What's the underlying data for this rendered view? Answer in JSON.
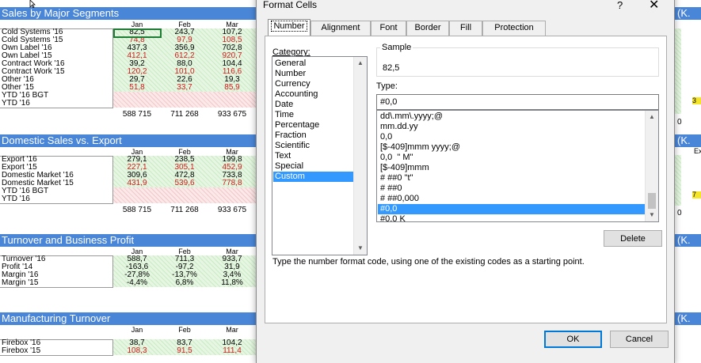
{
  "sheet": {
    "sections": [
      {
        "title": "Sales by Major Segments",
        "months": [
          "Jan",
          "Feb",
          "Mar"
        ],
        "rows": [
          {
            "label": "Cold Systems '16",
            "v": [
              "82,5",
              "243,7",
              "107,2"
            ],
            "red": false
          },
          {
            "label": "Cold Systems '15",
            "v": [
              "74,8",
              "97,9",
              "108,5"
            ],
            "red": true
          },
          {
            "label": "Own Label '16",
            "v": [
              "437,3",
              "356,9",
              "702,8"
            ],
            "red": false
          },
          {
            "label": "Own Label '15",
            "v": [
              "412,1",
              "612,2",
              "920,7"
            ],
            "red": true
          },
          {
            "label": "Contract Work '16",
            "v": [
              "39,2",
              "88,0",
              "104,4"
            ],
            "red": false
          },
          {
            "label": "Contract Work '15",
            "v": [
              "120,2",
              "101,0",
              "116,6"
            ],
            "red": true
          },
          {
            "label": "Other '16",
            "v": [
              "29,7",
              "22,6",
              "19,3"
            ],
            "red": false
          },
          {
            "label": "Other '15",
            "v": [
              "51,8",
              "33,7",
              "85,9"
            ],
            "red": true
          },
          {
            "label": "YTD '16 BGT",
            "v": [
              "",
              "",
              ""
            ],
            "red": false
          },
          {
            "label": "YTD '16",
            "v": [
              "",
              "",
              ""
            ],
            "red": false
          }
        ],
        "totals": [
          "588 715",
          "711 268",
          "933 675"
        ]
      },
      {
        "title": "Domestic Sales vs. Export",
        "months": [
          "Jan",
          "Feb",
          "Mar"
        ],
        "rows": [
          {
            "label": "Export '16",
            "v": [
              "279,1",
              "238,5",
              "199,8"
            ],
            "red": false
          },
          {
            "label": "Export '15",
            "v": [
              "227,1",
              "305,1",
              "452,9"
            ],
            "red": true
          },
          {
            "label": "Domestic Market '16",
            "v": [
              "309,6",
              "472,8",
              "733,8"
            ],
            "red": false
          },
          {
            "label": "Domestic Market '15",
            "v": [
              "431,9",
              "539,6",
              "778,8"
            ],
            "red": true
          },
          {
            "label": "YTD '16 BGT",
            "v": [
              "",
              "",
              ""
            ],
            "red": false
          },
          {
            "label": "YTD '16",
            "v": [
              "",
              "",
              ""
            ],
            "red": false
          }
        ],
        "totals": [
          "588 715",
          "711 268",
          "933 675"
        ]
      },
      {
        "title": "Turnover and Business Profit",
        "months": [
          "Jan",
          "Feb",
          "Mar"
        ],
        "rows": [
          {
            "label": "Turnover '16",
            "v": [
              "588,7",
              "711,3",
              "933,7"
            ],
            "red": false
          },
          {
            "label": "Profit '14",
            "v": [
              "-163,6",
              "-97,2",
              "31,9"
            ],
            "red": false
          },
          {
            "label": "Margin '16",
            "v": [
              "-27,8%",
              "-13,7%",
              "3,4%"
            ],
            "red": false
          },
          {
            "label": "Margin '15",
            "v": [
              "-4,4%",
              "6,8%",
              "11,8%"
            ],
            "red": false
          }
        ]
      },
      {
        "title": "Manufacturing Turnover",
        "months": [
          "Jan",
          "Feb",
          "Mar"
        ],
        "rows": [
          {
            "label": "Firebox '16",
            "v": [
              "38,7",
              "83,7",
              "104,2"
            ],
            "red": false
          },
          {
            "label": "Firebox '15",
            "v": [
              "108,3",
              "91,5",
              "111,4"
            ],
            "red": true
          }
        ]
      }
    ],
    "right_labels": [
      "(K.",
      "(K.",
      "(K.",
      "(K."
    ],
    "right_values": [
      "3",
      "0",
      "7",
      "0"
    ],
    "right_extra": "Ex"
  },
  "dialog": {
    "title": "Format Cells",
    "help": "?",
    "close": "✕",
    "tabs": [
      "Number",
      "Alignment",
      "Font",
      "Border",
      "Fill",
      "Protection"
    ],
    "active_tab": "Number",
    "category_label": "Category:",
    "categories": [
      "General",
      "Number",
      "Currency",
      "Accounting",
      "Date",
      "Time",
      "Percentage",
      "Fraction",
      "Scientific",
      "Text",
      "Special",
      "Custom"
    ],
    "selected_category": "Custom",
    "sample_label": "Sample",
    "sample_value": "82,5",
    "type_label": "Type:",
    "type_value": "#0,0",
    "formats": [
      "dd\\.mm\\.yyyy;@",
      "mm.dd.yy",
      "0,0",
      "[$-409]mmm yyyy;@",
      "0,0  \" M\"",
      "[$-409]mmm",
      "# ##0 \"t\"",
      "# ##0",
      "# ##0,000",
      "#0,0",
      "#0,0 K"
    ],
    "selected_format": "#0,0",
    "delete_label": "Delete",
    "hint": "Type the number format code, using one of the existing codes as a starting point.",
    "ok_label": "OK",
    "cancel_label": "Cancel"
  },
  "colors": {
    "accent": "#4a86d8",
    "selection": "#3399ff",
    "negative": "#d11a1a"
  }
}
